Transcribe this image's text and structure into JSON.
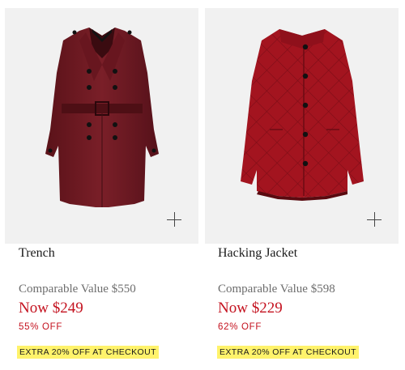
{
  "products": [
    {
      "name": "Trench",
      "comparable": "Comparable Value $550",
      "now": "Now $249",
      "discount": "55% OFF",
      "promo": "EXTRA 20% OFF AT CHECKOUT",
      "image_icon": "trench-coat-image",
      "color": "#6e1a22"
    },
    {
      "name": "Hacking Jacket",
      "comparable": "Comparable Value $598",
      "now": "Now $229",
      "discount": "62% OFF",
      "promo": "EXTRA 20% OFF AT CHECKOUT",
      "image_icon": "quilted-jacket-image",
      "color": "#a3141f"
    }
  ],
  "colors": {
    "price_red": "#c4121f",
    "promo_yellow": "#fff36b",
    "tile_bg": "#f1f1f1"
  }
}
